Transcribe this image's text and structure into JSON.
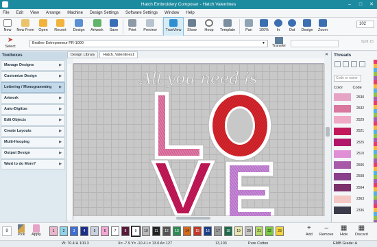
{
  "window": {
    "title": "Hatch Embroidery Composer - Hatch Valentines"
  },
  "menu": [
    "File",
    "Edit",
    "View",
    "Arrange",
    "Machine",
    "Design Settings",
    "Software Settings",
    "Window",
    "Help"
  ],
  "toolbar": {
    "new": "New",
    "new_from": "New From",
    "open": "Open",
    "recent": "Recent",
    "design": "Design",
    "artwork": "Artwork",
    "save": "Save",
    "print": "Print",
    "preview": "Preview",
    "trueview": "TrueView",
    "show": "Show",
    "hoop": "Hoop",
    "template": "Template",
    "pan": "Pan",
    "zoom100": "100%",
    "in": "In",
    "out": "Out",
    "design_zoom": "Design",
    "zoom": "Zoom",
    "zoom_value": "102"
  },
  "subbar": {
    "select": "Select",
    "machine": "Brother Entrepreneur PR-1000",
    "transfer": "Transfer",
    "split": "Split 15"
  },
  "toolbox": {
    "title": "Toolboxes",
    "items": [
      "Manage Designs",
      "Customize Design",
      "Lettering / Monogramming",
      "Artwork",
      "Auto-Digitize",
      "Edit Objects",
      "Create Layouts",
      "Multi-Hooping",
      "Output Design",
      "Want to do More?"
    ]
  },
  "tabs": [
    "Design Library",
    "Hatch_Valentines1"
  ],
  "canvas": {
    "script_text": "All you need is",
    "letters": [
      "L",
      "O",
      "V",
      "E"
    ]
  },
  "threads": {
    "title": "Threads",
    "filter_placeholder": "Code or name",
    "col_color": "Color",
    "col_code": "Code",
    "rows": [
      {
        "code": "2530",
        "color": "#e7a3c6"
      },
      {
        "code": "2532",
        "color": "#d9779f"
      },
      {
        "code": "2529",
        "color": "#f0a9c4"
      },
      {
        "code": "2521",
        "color": "#c2185b"
      },
      {
        "code": "2525",
        "color": "#b2166a"
      },
      {
        "code": "2510",
        "color": "#e08fd6"
      },
      {
        "code": "2506",
        "color": "#a85aa8"
      },
      {
        "code": "2508",
        "color": "#8a3f8a"
      },
      {
        "code": "2504",
        "color": "#7c2f6b"
      },
      {
        "code": "2363",
        "color": "#f4c7c5"
      },
      {
        "code": "2336",
        "color": "#3a3a4a"
      }
    ]
  },
  "palette": {
    "count": "9",
    "pick": "Pick",
    "apply": "Apply",
    "chips": [
      {
        "n": "1",
        "color": "#e9b5cc"
      },
      {
        "n": "2",
        "color": "#8fd3e8"
      },
      {
        "n": "3",
        "color": "#3d6fd6"
      },
      {
        "n": "4",
        "color": "#1c2f8a"
      },
      {
        "n": "5",
        "color": "#c8d0e0"
      },
      {
        "n": "6",
        "color": "#f3a8d4"
      },
      {
        "n": "7",
        "color": "#ffffff"
      },
      {
        "n": "8",
        "color": "#5a1a3a"
      },
      {
        "n": "9",
        "color": "#ffffff"
      },
      {
        "n": "10",
        "color": "#b9b9b9"
      },
      {
        "n": "11",
        "color": "#222222"
      },
      {
        "n": "12",
        "color": "#555555"
      },
      {
        "n": "13",
        "color": "#2e8b57"
      },
      {
        "n": "14",
        "color": "#d2691e"
      },
      {
        "n": "15",
        "color": "#c0392b"
      },
      {
        "n": "16",
        "color": "#1c3f8a"
      },
      {
        "n": "17",
        "color": "#9b9b9b"
      },
      {
        "n": "18",
        "color": "#1e6b4a"
      },
      {
        "n": "19",
        "color": "#e8e4b0"
      },
      {
        "n": "20",
        "color": "#c6c6c6"
      },
      {
        "n": "21",
        "color": "#b7d96b"
      },
      {
        "n": "22",
        "color": "#7ac943"
      },
      {
        "n": "23",
        "color": "#f2d23c"
      }
    ],
    "add": "Add",
    "remove": "Remove",
    "hide": "Hide",
    "discard": "Discard"
  },
  "status": {
    "size": "W: 70.4 H 100.3",
    "coords": "X=  -7.9 Y=  -10.4 L=  13.0 A=  127",
    "stitches": "13,103",
    "fabric": "Pure Cotton",
    "grade": "EMB Grade: A"
  }
}
